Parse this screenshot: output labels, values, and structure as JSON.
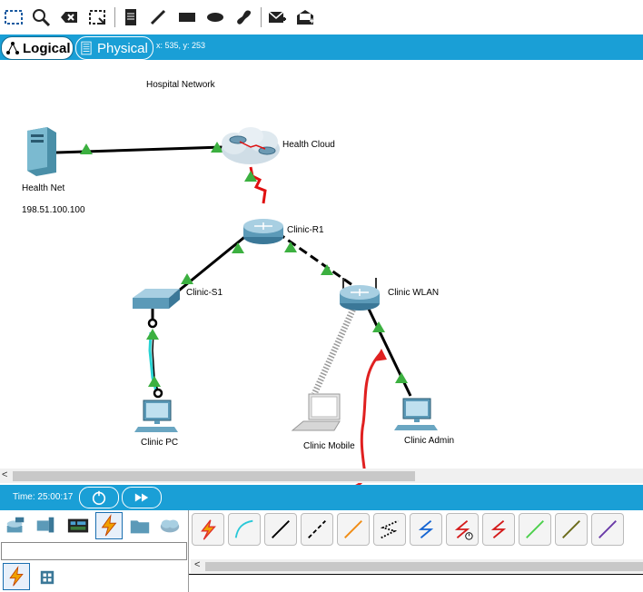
{
  "toolbar": {
    "icons": [
      "select-icon",
      "zoom-icon",
      "delete-icon",
      "resize-icon",
      "note-icon",
      "line-icon",
      "rectangle-icon",
      "ellipse-icon",
      "freeform-icon",
      "add-pdu-icon",
      "add-complex-pdu-icon"
    ]
  },
  "modebar": {
    "logical_label": "Logical",
    "physical_label": "Physical",
    "coords": "x: 535, y: 253"
  },
  "canvas": {
    "title": "Hospital Network",
    "devices": {
      "health_net": "Health Net",
      "health_net_ip": "198.51.100.100",
      "health_cloud": "Health Cloud",
      "clinic_r1": "Clinic-R1",
      "clinic_s1": "Clinic-S1",
      "clinic_wlan": "Clinic WLAN",
      "clinic_pc": "Clinic PC",
      "clinic_mobile": "Clinic Mobile",
      "clinic_admin": "Clinic Admin"
    },
    "colors": {
      "link_up": "#3cb040",
      "serial": "#e01010",
      "fiber_console": "#29d3d3",
      "annotation": "#e02020"
    }
  },
  "timebar": {
    "time": "Time: 25:00:17"
  },
  "bottom": {
    "categories": [
      "network-devices-icon",
      "end-devices-icon",
      "components-icon",
      "connections-icon",
      "misc-icon",
      "multiuser-icon"
    ],
    "subcategories": [
      "connections-lightning-icon",
      "grid-icon"
    ],
    "cables": [
      {
        "name": "automatic-cable",
        "color": "#e0302a"
      },
      {
        "name": "console-cable",
        "color": "#29c8d8"
      },
      {
        "name": "copper-straight-through",
        "color": "#000000"
      },
      {
        "name": "copper-cross-over",
        "color": "#000000"
      },
      {
        "name": "fiber-cable",
        "color": "#f08c14"
      },
      {
        "name": "phone-cable",
        "color": "#000000"
      },
      {
        "name": "coaxial-cable",
        "color": "#1464d2"
      },
      {
        "name": "serial-dce-cable",
        "color": "#d41a1a"
      },
      {
        "name": "serial-dte-cable",
        "color": "#d41a1a"
      },
      {
        "name": "octal-cable",
        "color": "#4cd04c"
      },
      {
        "name": "iot-custom-cable",
        "color": "#6a6a1a"
      },
      {
        "name": "usb-cable",
        "color": "#6a3aa8"
      }
    ]
  }
}
